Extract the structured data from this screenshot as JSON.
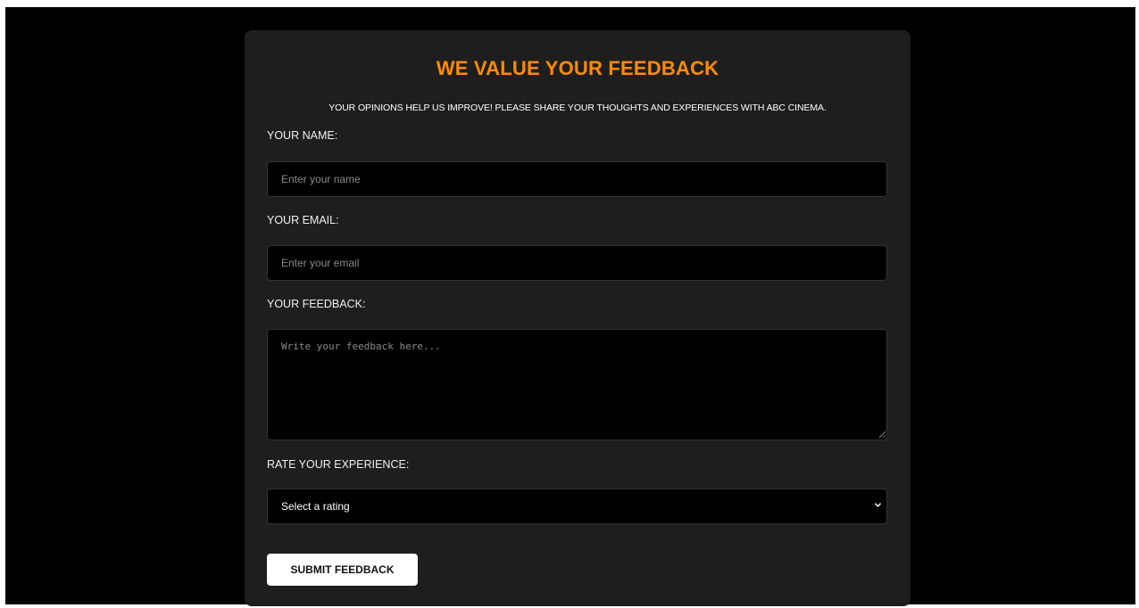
{
  "form": {
    "title": "WE VALUE YOUR FEEDBACK",
    "subtitle": "YOUR OPINIONS HELP US IMPROVE! PLEASE SHARE YOUR THOUGHTS AND EXPERIENCES WITH ABC CINEMA.",
    "name": {
      "label": "YOUR NAME:",
      "placeholder": "Enter your name",
      "value": ""
    },
    "email": {
      "label": "YOUR EMAIL:",
      "placeholder": "Enter your email",
      "value": ""
    },
    "feedback": {
      "label": "YOUR FEEDBACK:",
      "placeholder": "Write your feedback here...",
      "value": ""
    },
    "rating": {
      "label": "RATE YOUR EXPERIENCE:",
      "selected": "Select a rating",
      "icon": "chevron-down-icon"
    },
    "submit_label": "SUBMIT FEEDBACK"
  },
  "colors": {
    "page_background": "#000000",
    "card_background": "#1e1e1e",
    "accent": "#ff8c00",
    "field_background": "#000000",
    "button_background": "#ffffff"
  }
}
